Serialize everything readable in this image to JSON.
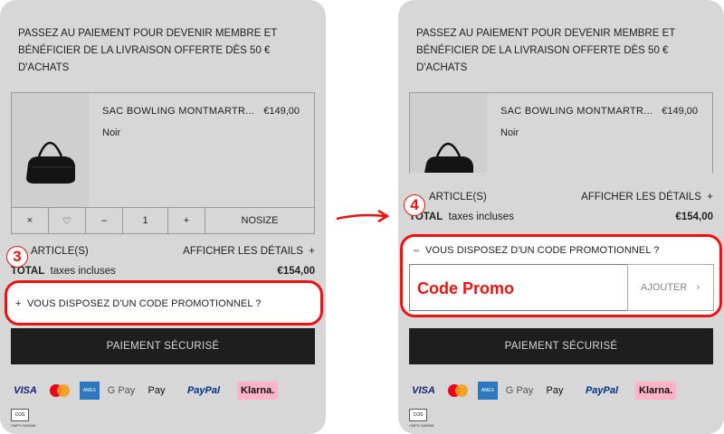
{
  "banner": "PASSEZ AU PAIEMENT POUR DEVENIR MEMBRE ET BÉNÉFICIER DE LA LIVRAISON OFFERTE DÈS 50 € D'ACHATS",
  "product": {
    "name": "SAC BOWLING MONTMARTR...",
    "price": "€149,00",
    "color": "Noir",
    "qty": "1",
    "size": "NOSIZE",
    "remove": "×",
    "favorite": "♡",
    "minus": "–",
    "plus": "+"
  },
  "summary": {
    "articles": "ARTICLE(S)",
    "details": "AFFICHER LES DÉTAILS",
    "details_plus": "+",
    "total": "TOTAL",
    "taxes": "taxes incluses",
    "amount": "€154,00"
  },
  "promo": {
    "collapsed_label": "VOUS DISPOSEZ D'UN CODE PROMOTIONNEL ?",
    "expanded_label": "VOUS DISPOSEZ D'UN CODE PROMOTIONNEL ?",
    "plus": "+",
    "minus": "–",
    "input_text": "Code Promo",
    "add_button": "AJOUTER",
    "add_chevron": "›"
  },
  "pay_button": "PAIEMENT SÉCURISÉ",
  "payment_methods": [
    "VISA",
    "Mastercard",
    "Amex",
    "G Pay",
    "Pay",
    "PayPal",
    "Klarna."
  ],
  "brand_badge": "COS",
  "brand_sub": "CMPS GARAM",
  "steps": {
    "left": "3",
    "right": "4"
  },
  "colors": {
    "accent": "#e11111",
    "dark_button": "#1e1e1e",
    "overlay": "#d7d7d7"
  }
}
